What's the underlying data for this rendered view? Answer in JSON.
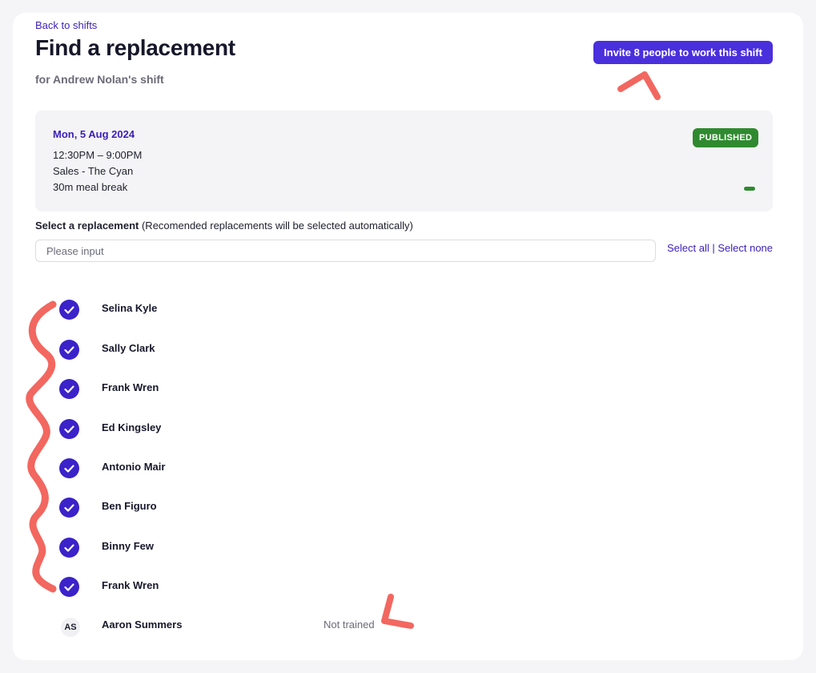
{
  "header": {
    "back_link": "Back to shifts",
    "title": "Find a replacement",
    "subtitle": "for Andrew Nolan's shift",
    "invite_button": "Invite 8 people to work this shift"
  },
  "shift": {
    "date": "Mon, 5 Aug 2024",
    "time": "12:30PM – 9:00PM",
    "location": "Sales - The Cyan",
    "meal_break": "30m meal break",
    "status": "PUBLISHED",
    "status_color": "#2f8a2f"
  },
  "replacement": {
    "label_bold": "Select a replacement",
    "label_note": " (Recomended replacements will be selected automatically)",
    "search_placeholder": "Please input",
    "select_all": "Select all",
    "separator": " | ",
    "select_none": "Select none"
  },
  "people": [
    {
      "name": "Selina Kyle",
      "selected": true,
      "icon": "check-icon"
    },
    {
      "name": "Sally Clark",
      "selected": true,
      "icon": "check-icon"
    },
    {
      "name": "Frank Wren",
      "selected": true,
      "icon": "check-icon"
    },
    {
      "name": "Ed Kingsley",
      "selected": true,
      "icon": "check-icon"
    },
    {
      "name": "Antonio Mair",
      "selected": true,
      "icon": "check-icon"
    },
    {
      "name": "Ben Figuro",
      "selected": true,
      "icon": "check-icon"
    },
    {
      "name": "Binny Few",
      "selected": true,
      "icon": "check-icon"
    },
    {
      "name": "Frank Wren",
      "selected": true,
      "icon": "check-icon"
    },
    {
      "name": "Aaron Summers",
      "selected": false,
      "initials": "AS",
      "note": "Not trained"
    }
  ],
  "colors": {
    "accent": "#4a2fdc",
    "check": "#3b22c9",
    "link": "#3b1fb8",
    "annotation": "#f2675f"
  }
}
